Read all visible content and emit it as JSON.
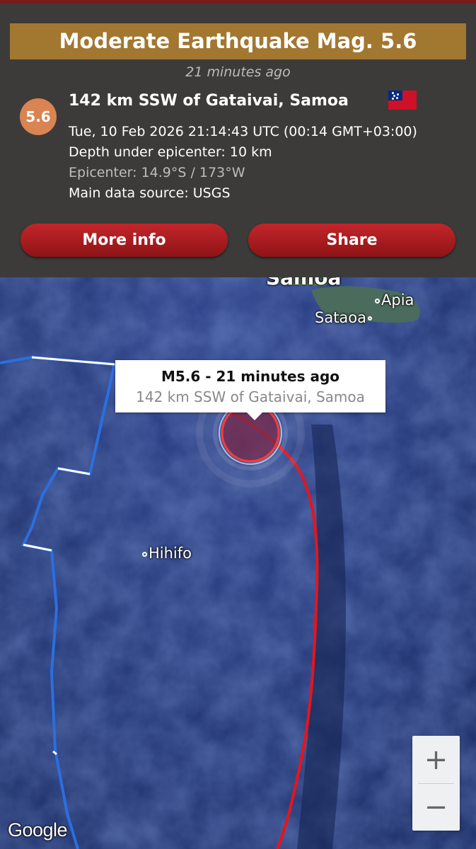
{
  "header": {
    "title": "Moderate Earthquake Mag. 5.6",
    "time_ago": "21 minutes ago"
  },
  "event": {
    "magnitude": "5.6",
    "location": "142 km SSW of Gataivai, Samoa",
    "datetime": "Tue, 10 Feb 2026 21:14:43 UTC (00:14 GMT+03:00)",
    "depth": "Depth under epicenter: 10 km",
    "epicenter": "Epicenter: 14.9°S / 173°W",
    "source": "Main data source: USGS",
    "flag_icon": "samoa-flag-icon"
  },
  "buttons": {
    "more_info": "More info",
    "share": "Share"
  },
  "map": {
    "labels": {
      "region": "Samoa",
      "apia": "Apia",
      "sataoa": "Sataoa",
      "hihifo": "Hihifo"
    },
    "popup": {
      "title": "M5.6  -  21 minutes ago",
      "subtitle": "142 km SSW of Gataivai, Samoa"
    },
    "zoom_in": "+",
    "zoom_out": "−",
    "attribution": "Google"
  },
  "colors": {
    "banner": "#a27730",
    "badge": "#d98452",
    "button": "#b01d21",
    "plate_boundary_red": "#e8141c",
    "plate_boundary_blue": "#2a6fe0"
  }
}
